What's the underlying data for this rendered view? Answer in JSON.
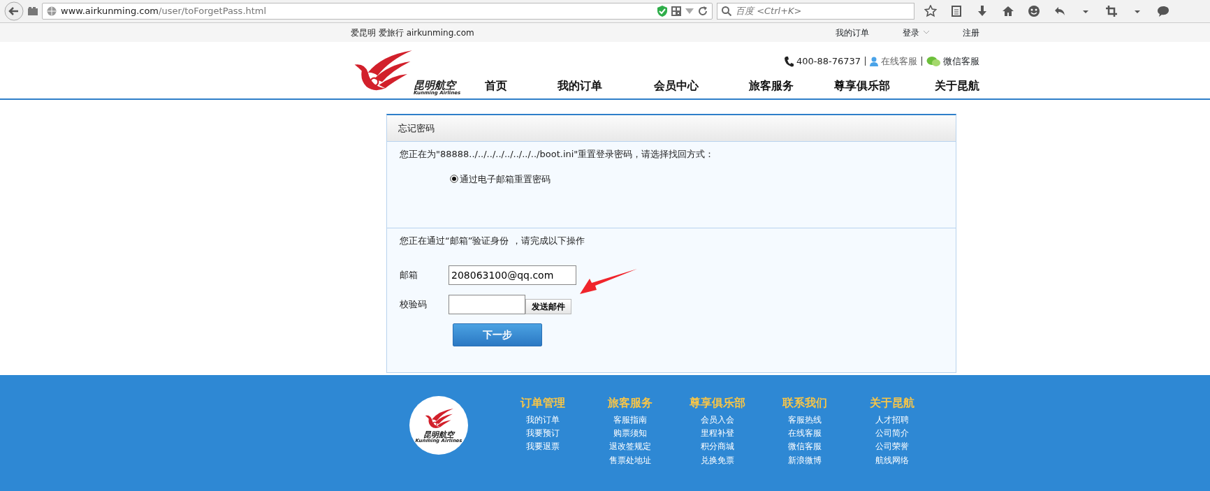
{
  "browser": {
    "address_host": "www.airkunming.com",
    "address_path": "/user/toForgetPass.html",
    "search_placeholder": "百度 <Ctrl+K>"
  },
  "top_bar": {
    "slogan": "爱昆明 爱旅行 airkunming.com",
    "links": [
      {
        "label": "我的订单",
        "dropdown": false
      },
      {
        "label": "登录",
        "dropdown": true
      },
      {
        "label": "注册",
        "dropdown": false
      }
    ]
  },
  "header": {
    "logo": {
      "name": "昆明航空",
      "english": "Kunming Airlines"
    },
    "phone": "400-88-76737",
    "online_service": "在线客服",
    "wechat_service": "微信客服",
    "nav": [
      "首页",
      "我的订单",
      "会员中心",
      "旅客服务",
      "尊享俱乐部",
      "关于昆航"
    ]
  },
  "form": {
    "title": "忘记密码",
    "prompt": "您正在为\"88888../../../../../../../../boot.ini\"重置登录密码，请选择找回方式：",
    "options": [
      {
        "label": "通过电子邮箱重置密码",
        "selected": true
      }
    ],
    "verify_note": "您正在通过“邮箱”验证身份 ，请完成以下操作",
    "fields": [
      {
        "label": "邮箱",
        "value": "208063100@qq.com"
      },
      {
        "label": "校验码",
        "button": "发送邮件"
      }
    ],
    "next_button": "下一步"
  },
  "footer": {
    "logo": {
      "name": "昆明航空",
      "english": "Kunming Airlines"
    },
    "columns": [
      {
        "title": "订单管理",
        "links": [
          "我的订单",
          "我要预订",
          "我要退票"
        ]
      },
      {
        "title": "旅客服务",
        "links": [
          "客服指南",
          "购票须知",
          "退改签规定",
          "售票处地址"
        ]
      },
      {
        "title": "尊享俱乐部",
        "links": [
          "会员入会",
          "里程补登",
          "积分商城",
          "兑换免票"
        ]
      },
      {
        "title": "联系我们",
        "links": [
          "客服热线",
          "在线客服",
          "微信客服",
          "新浪微博"
        ]
      },
      {
        "title": "关于昆航",
        "links": [
          "人才招聘",
          "公司简介",
          "公司荣誉",
          "航线网络"
        ]
      }
    ]
  }
}
